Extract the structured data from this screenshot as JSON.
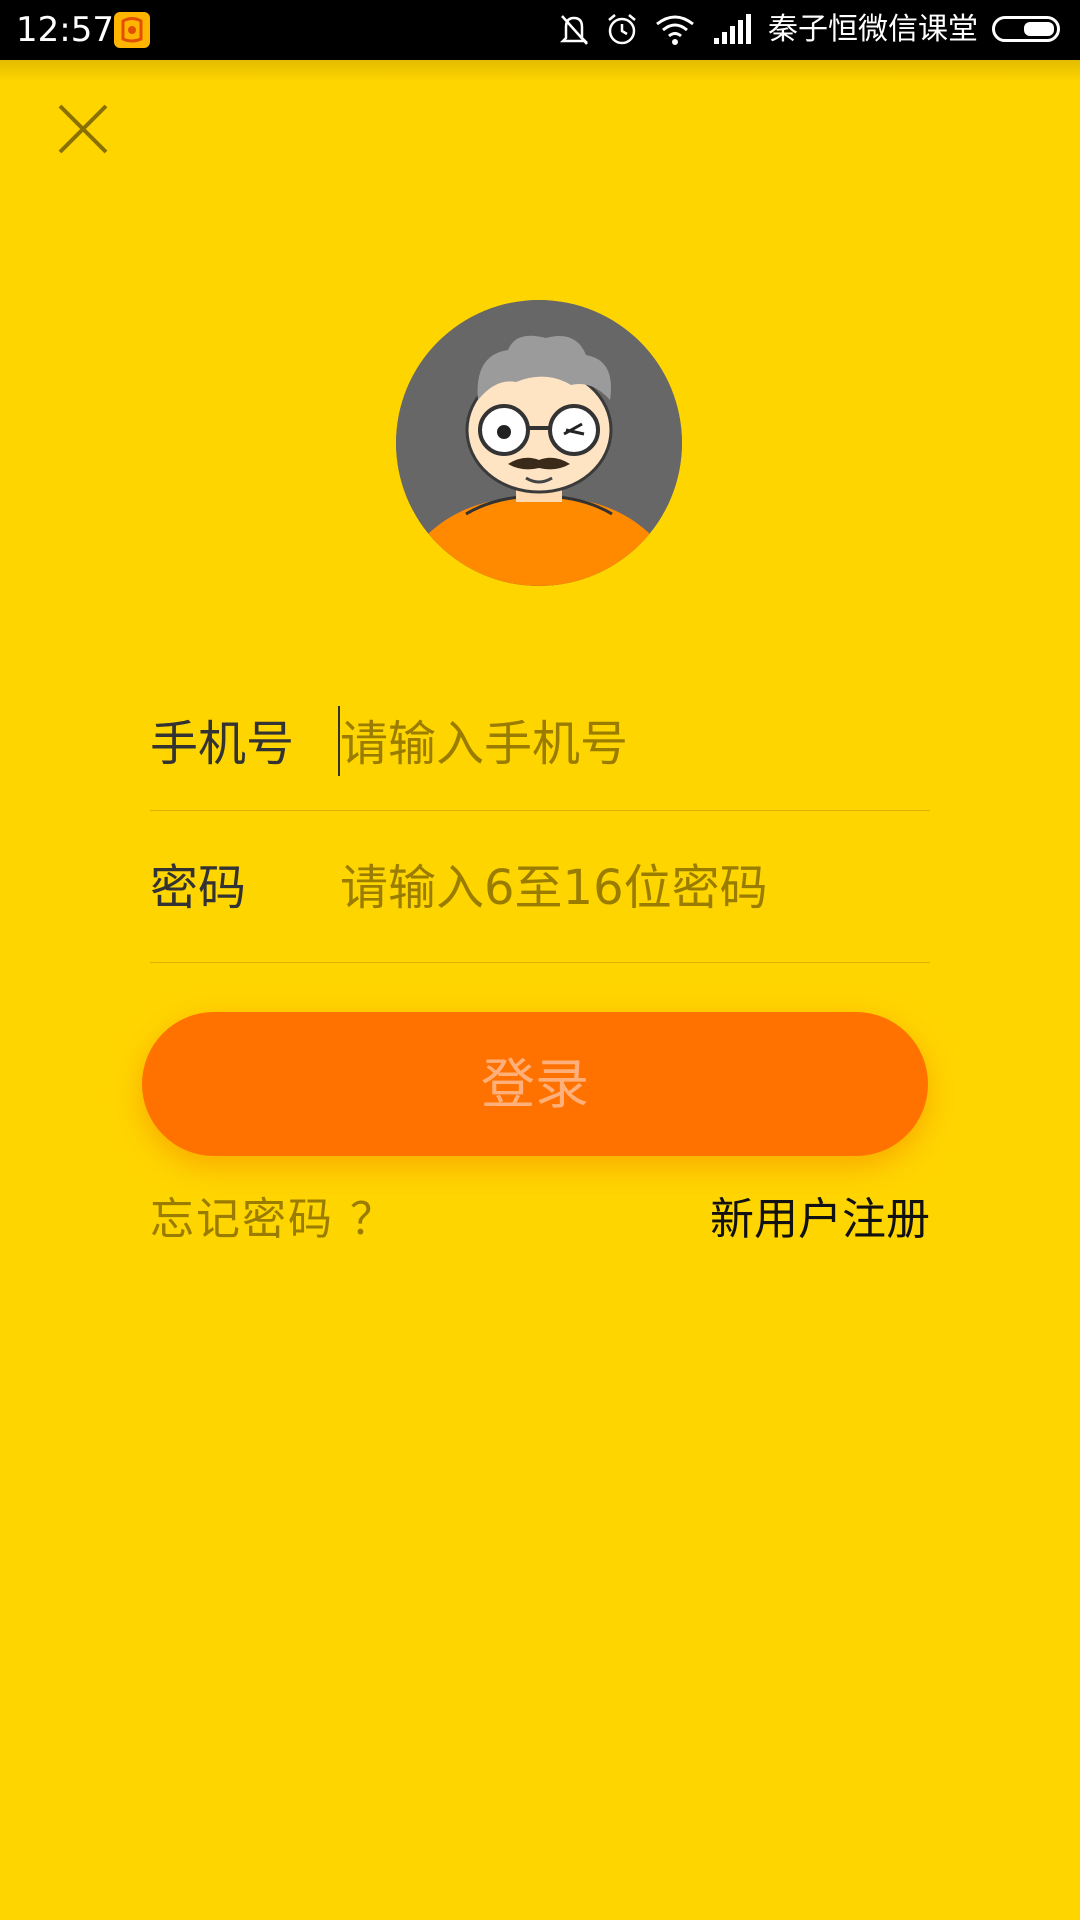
{
  "status_bar": {
    "time": "12:57",
    "carrier": "秦子恒微信课堂",
    "icons": [
      "app-icon",
      "mute-bell-icon",
      "alarm-icon",
      "wifi-icon",
      "signal-icon",
      "battery-icon"
    ]
  },
  "colors": {
    "background": "#ffd500",
    "button": "#ff7200",
    "button_text": "#ffb07a",
    "placeholder": "#9a7d00"
  },
  "form": {
    "phone_label": "手机号",
    "phone_placeholder": "请输入手机号",
    "password_label": "密码",
    "password_placeholder": "请输入6至16位密码",
    "login_label": "登录",
    "forgot_label": "忘记密码 ？",
    "register_label": "新用户注册"
  }
}
